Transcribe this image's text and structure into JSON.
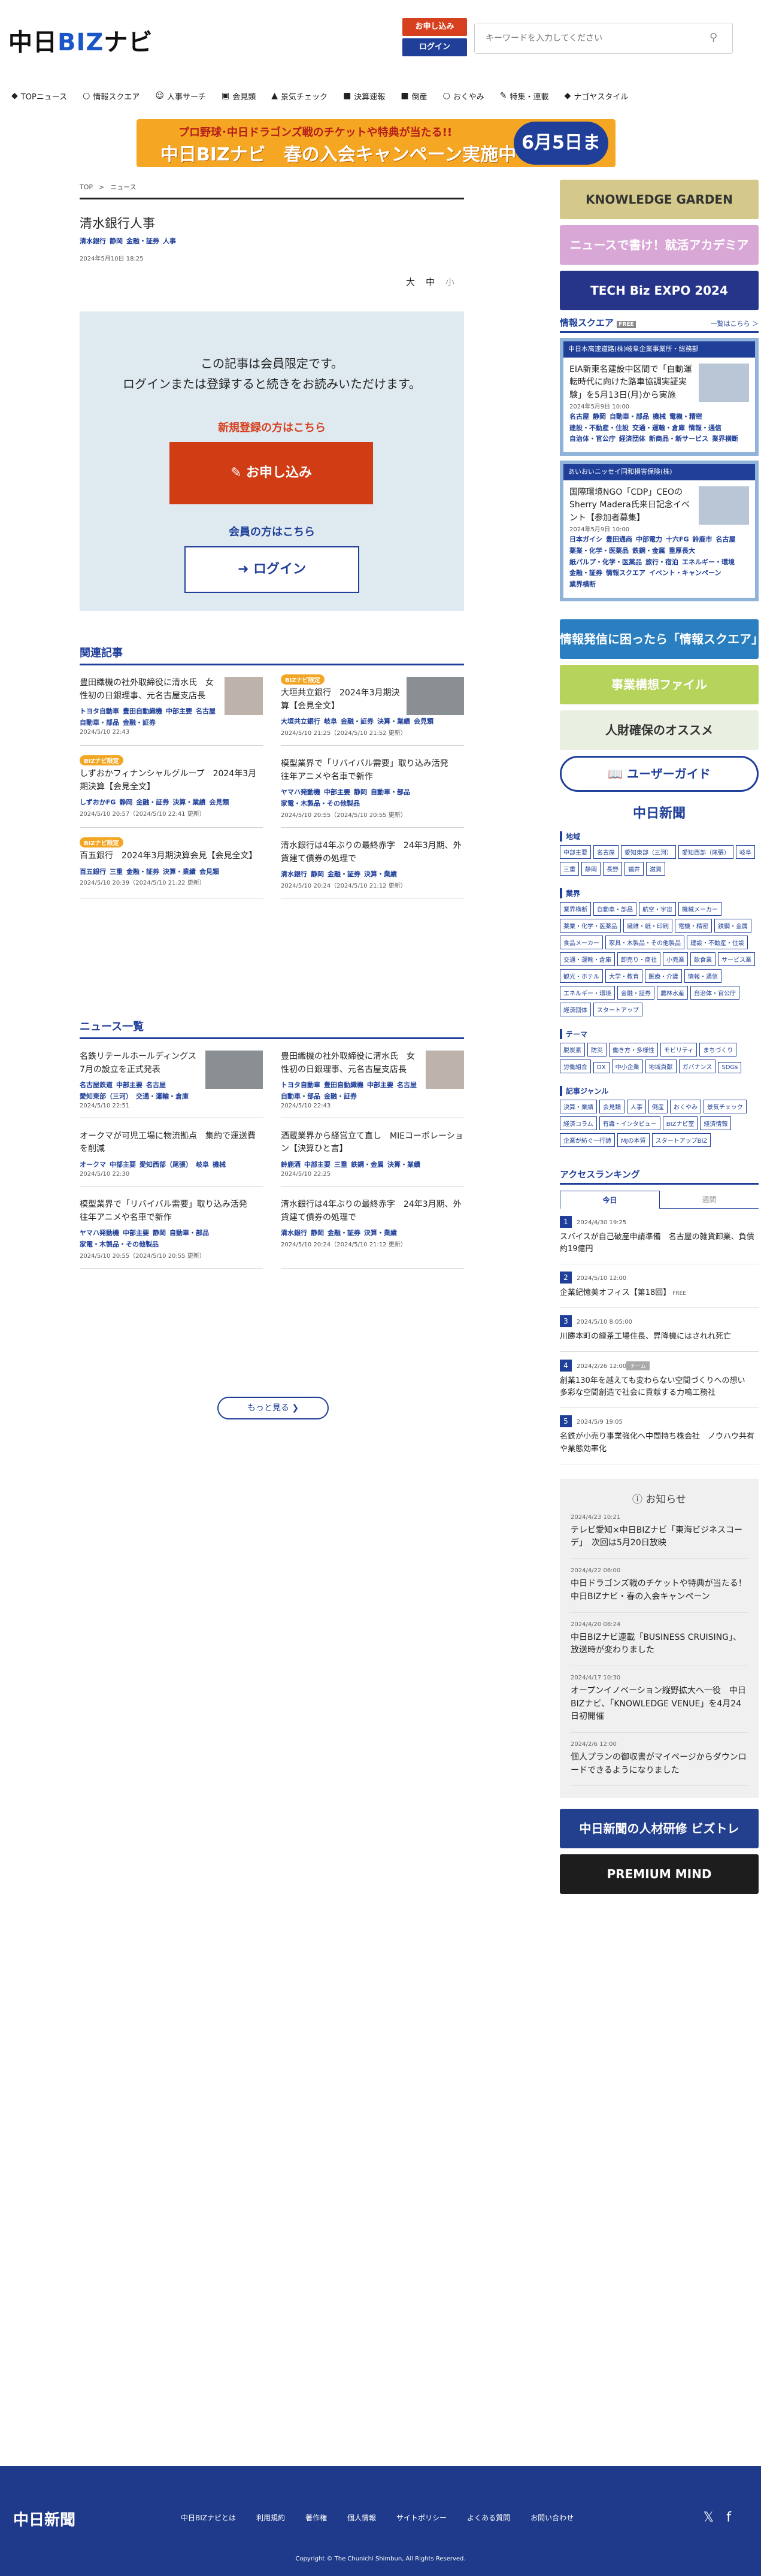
{
  "header": {
    "apply": "お申し込み",
    "login": "ログイン",
    "search_placeholder": "キーワードを入力してください"
  },
  "nav": [
    "TOPニュース",
    "情報スクエア",
    "人事サーチ",
    "会見類",
    "景気チェック",
    "決算速報",
    "倒産",
    "おくやみ",
    "特集・連載",
    "ナゴヤスタイル"
  ],
  "campaign": {
    "line1": "プロ野球･中日ドラゴンズ戦のチケットや特典が当たる!!",
    "line2": "中日BIZナビ　春の入会キャンペーン実施中",
    "badge": "6月5日まで"
  },
  "breadcrumb": [
    "TOP",
    ">",
    "ニュース"
  ],
  "article": {
    "title": "清水銀行人事",
    "tags": [
      "清水銀行",
      "静岡",
      "金融・証券",
      "人事"
    ],
    "date": "2024年5月10日 18:25",
    "font_sizes": [
      "大",
      "中",
      "小"
    ]
  },
  "gate": {
    "msg1": "この記事は会員限定です。",
    "msg2": "ログインまたは登録すると続きをお読みいただけます。",
    "new": "新規登録の方はこちら",
    "apply": "お申し込み",
    "member": "会員の方はこちら",
    "login": "ログイン"
  },
  "related": {
    "title": "関連記事",
    "items": [
      {
        "title": "豊田織機の社外取締役に清水氏　女性初の日銀理事、元名古屋支店長",
        "tags": [
          "トヨタ自動車",
          "豊田自動織機",
          "中部主要",
          "名古屋",
          "自動車・部品",
          "金融・証券"
        ],
        "date": "2024/5/10 22:43",
        "thumb": "p"
      },
      {
        "label": "BIZナビ限定",
        "title": "大垣共立銀行　2024年3月期決算【会見全文】",
        "tags": [
          "大垣共立銀行",
          "岐阜",
          "金融・証券",
          "決算・業績",
          "会見類"
        ],
        "date": "2024/5/10 21:25（2024/5/10 21:52 更新）",
        "thumb": "w"
      },
      {
        "label": "BIZナビ限定",
        "title": "しずおかフィナンシャルグループ　2024年3月期決算【会見全文】",
        "tags": [
          "しずおかFG",
          "静岡",
          "金融・証券",
          "決算・業績",
          "会見類"
        ],
        "date": "2024/5/10 20:57（2024/5/10 22:41 更新）"
      },
      {
        "title": "模型業界で「リバイバル需要」取り込み活発　往年アニメや名車で新作",
        "tags": [
          "ヤマハ発動機",
          "中部主要",
          "静岡",
          "自動車・部品",
          "家電・木製品・その他製品"
        ],
        "date": "2024/5/10 20:55（2024/5/10 20:55 更新）"
      },
      {
        "label": "BIZナビ限定",
        "title": "百五銀行　2024年3月期決算会見【会見全文】",
        "tags": [
          "百五銀行",
          "三重",
          "金融・証券",
          "決算・業績",
          "会見類"
        ],
        "date": "2024/5/10 20:39（2024/5/10 21:22 更新）"
      },
      {
        "title": "清水銀行は4年ぶりの最終赤字　24年3月期、外貨建て債券の処理で",
        "tags": [
          "清水銀行",
          "静岡",
          "金融・証券",
          "決算・業績"
        ],
        "date": "2024/5/10 20:24（2024/5/10 21:12 更新）"
      }
    ]
  },
  "news": {
    "title": "ニュース一覧",
    "more": "もっと見る",
    "items": [
      {
        "title": "名鉄リテールホールディングス　7月の設立を正式発表",
        "tags": [
          "名古屋鉄道",
          "中部主要",
          "名古屋",
          "愛知東部（三河）",
          "交通・運輸・倉庫"
        ],
        "date": "2024/5/10 22:51",
        "thumb": "w"
      },
      {
        "title": "豊田織機の社外取締役に清水氏　女性初の日銀理事、元名古屋支店長",
        "tags": [
          "トヨタ自動車",
          "豊田自動織機",
          "中部主要",
          "名古屋",
          "自動車・部品",
          "金融・証券"
        ],
        "date": "2024/5/10 22:43",
        "thumb": "p"
      },
      {
        "title": "オークマが可児工場に物流拠点　集約で運送費を削減",
        "tags": [
          "オークマ",
          "中部主要",
          "愛知西部（尾張）",
          "岐阜",
          "機械"
        ],
        "date": "2024/5/10 22:30"
      },
      {
        "title": "酒蔵業界から経営立て直し　MIEコーポレーション【決算ひと言】",
        "tags": [
          "鈴鹿酒",
          "中部主要",
          "三重",
          "鉄鋼・金属",
          "決算・業績"
        ],
        "date": "2024/5/10 22:25"
      },
      {
        "title": "模型業界で「リバイバル需要」取り込み活発　往年アニメや名車で新作",
        "tags": [
          "ヤマハ発動機",
          "中部主要",
          "静岡",
          "自動車・部品",
          "家電・木製品・その他製品"
        ],
        "date": "2024/5/10 20:55（2024/5/10 20:55 更新）"
      },
      {
        "title": "清水銀行は4年ぶりの最終赤字　24年3月期、外貨建て債券の処理で",
        "tags": [
          "清水銀行",
          "静岡",
          "金融・証券",
          "決算・業績"
        ],
        "date": "2024/5/10 20:24（2024/5/10 21:12 更新）"
      }
    ]
  },
  "side": {
    "banners": [
      {
        "text": "KNOWLEDGE GARDEN",
        "color": "#d4c98a"
      },
      {
        "text": "ニュースで書け！就活アカデミア",
        "color": "#d9a7d6"
      },
      {
        "text": "TECH Biz EXPO 2024",
        "color": "#26348a"
      }
    ],
    "square": {
      "title": "情報スクエア",
      "badge": "FREE",
      "more": "一覧はこちら ＞",
      "items": [
        {
          "hd": "中日本高速道路(株)岐阜企業事業所・総務部",
          "body": "EIA新東名建設中区間で「自動運転時代に向けた路車協調実証実験」を5月13日(月)から実施",
          "date": "2024年5月9日 10:00",
          "tags": [
            "名古屋",
            "静岡",
            "自動車・部品",
            "機械",
            "電機・精密",
            "建設・不動産・住設",
            "交通・運輸・倉庫",
            "情報・通信",
            "自治体・官公庁",
            "経済団体",
            "新商品・新サービス",
            "業界横断"
          ]
        },
        {
          "hd": "あいおいニッセイ同和損害保険(株)",
          "body": "国際環境NGO「CDP」CEOのSherry Madera氏来日記念イベント【参加者募集】",
          "date": "2024年5月9日 10:00",
          "tags": [
            "日本ガイシ",
            "豊田通商",
            "中部電力",
            "十六FG",
            "鈴鹿市",
            "名古屋",
            "薬業・化学・医薬品",
            "鉄鋼・金属",
            "重厚長大",
            "紙パルプ・化学・医薬品",
            "旅行・宿泊",
            "エネルギー・環境",
            "金融・証券",
            "情報スクエア",
            "イベント・キャンペーン",
            "業界横断"
          ]
        }
      ]
    },
    "banners2": [
      {
        "text": "情報発信に困ったら「情報スクエア」",
        "color": "#2a7fc0"
      },
      {
        "text": "事業構想ファイル",
        "color": "#b6d35b"
      },
      {
        "text": "人財確保のオススメ",
        "color": "#e9f0e2"
      }
    ],
    "guide": "ユーザーガイド",
    "paper": "中日新聞",
    "cats": [
      {
        "name": "地域",
        "items": [
          "中部主要",
          "名古屋",
          "愛知東部（三河）",
          "愛知西部（尾張）",
          "岐阜",
          "三重",
          "静岡",
          "長野",
          "福井",
          "滋賀"
        ]
      },
      {
        "name": "業界",
        "items": [
          "業界横断",
          "自動車・部品",
          "航空・宇宙",
          "機械メーカー",
          "薬業・化学・医薬品",
          "繊維・紙・印刷",
          "電機・精密",
          "鉄鋼・金属",
          "食品メーカー",
          "家具・木製品・その他製品",
          "建設・不動産・住設",
          "交通・運輸・倉庫",
          "卸売り・商社",
          "小売業",
          "飲食業",
          "サービス業",
          "観光・ホテル",
          "大学・教育",
          "医療・介護",
          "情報・通信",
          "エネルギー・環境",
          "金融・証券",
          "農林水産",
          "自治体・官公庁",
          "経済団体",
          "スタートアップ"
        ]
      },
      {
        "name": "テーマ",
        "items": [
          "脱炭素",
          "防災",
          "働き方・多様性",
          "モビリティ",
          "まちづくり",
          "労働組合",
          "DX",
          "中小企業",
          "地域貢献",
          "ガバナンス",
          "SDGs"
        ]
      },
      {
        "name": "記事ジャンル",
        "items": [
          "決算・業績",
          "会見類",
          "人事",
          "倒産",
          "おくやみ",
          "景気チェック",
          "経済コラム",
          "有識・インタビュー",
          "BIZナビ室",
          "経済情報",
          "企業が紡ぐ一行詩",
          "MJの本質",
          "スタートアップBIZ"
        ]
      }
    ],
    "ranking": {
      "title": "アクセスランキング",
      "tabs": [
        "今日",
        "週間"
      ],
      "items": [
        {
          "n": "1",
          "date": "2024/4/30 19:25",
          "title": "スバイスが自己破産申請準備　名古屋の雑貨卸業、負債約19億円"
        },
        {
          "n": "2",
          "date": "2024/5/10 12:00",
          "title": "企業紀憶美オフィス【第18回】",
          "badge": "FREE"
        },
        {
          "n": "3",
          "date": "2024/5/10 8:05:00",
          "title": "川勝本町の緑茶工場住長、昇降機にはされれ死亡"
        },
        {
          "n": "4",
          "date": "2024/2/26 12:00",
          "label": "チーム",
          "title": "創業130年を越えても変わらない空間づくりへの想い　多彩な空間創造で社会に貢献する力鳴工務社"
        },
        {
          "n": "5",
          "date": "2024/5/9 19:05",
          "title": "名鉄が小売り事業強化へ中間持ち株会社　ノウハウ共有や業態効率化"
        }
      ]
    },
    "notice": {
      "title": "お知らせ",
      "items": [
        {
          "date": "2024/4/23 10:21",
          "title": "テレビ愛知×中日BIZナビ「東海ビジネスコーデ」　次回は5月20日放映"
        },
        {
          "date": "2024/4/22 06:00",
          "title": "中日ドラゴンズ戦のチケットや特典が当たる！　中日BIZナビ・春の入会キャンペーン"
        },
        {
          "date": "2024/4/20 08:24",
          "title": "中日BIZナビ連載「BUSINESS CRUISING」、放送時が変わりました"
        },
        {
          "date": "2024/4/17 10:30",
          "title": "オープンイノベーション縦野拡大へ一役　中日BIZナビ、「KNOWLEDGE VENUE」を4月24日初開催"
        },
        {
          "date": "2024/2/6 12:00",
          "title": "個人プランの御収書がマイページからダウンロードできるようになりました"
        }
      ]
    },
    "banners3": [
      {
        "text": "中日新聞の人材研修 ビズトレ",
        "color": "#23408f"
      },
      {
        "text": "PREMIUM MIND",
        "color": "#1d1d1d"
      }
    ]
  },
  "footer": {
    "logo": "中日新聞",
    "links": [
      "中日BIZナビとは",
      "利用規約",
      "著作権",
      "個人情報",
      "サイトポリシー",
      "よくある質問",
      "お問い合わせ"
    ],
    "copyright": "Copyright © The Chunichi Shimbun, All Rights Reserved."
  }
}
